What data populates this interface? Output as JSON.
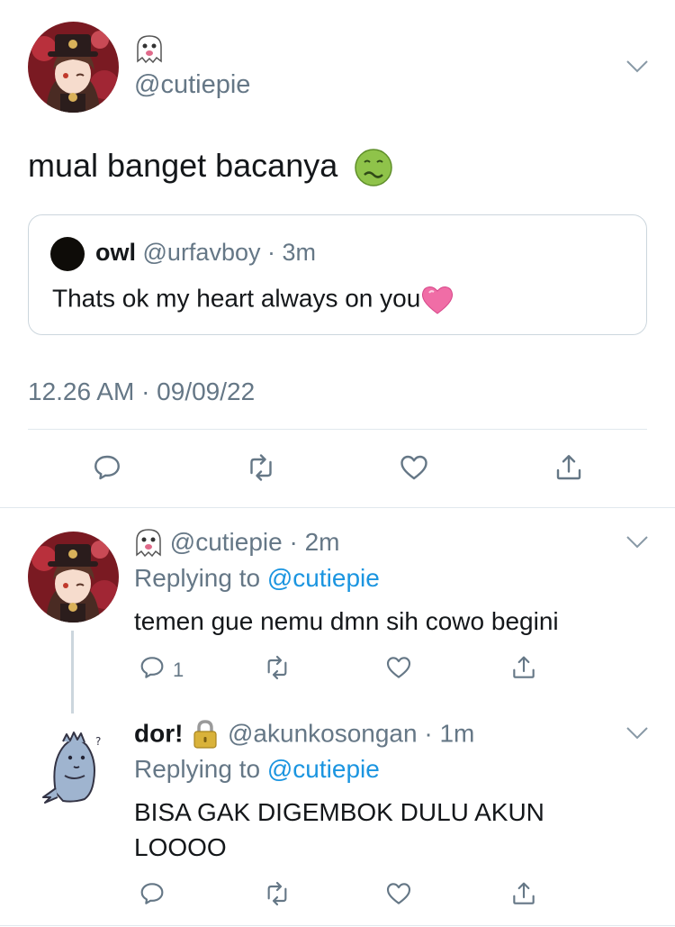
{
  "main_tweet": {
    "display_name_emoji": "ghost-emoji",
    "handle": "@cutiepie",
    "text": "mual banget bacanya",
    "text_emoji": "nauseated-face-emoji",
    "quote": {
      "name": "owl",
      "handle": "@urfavboy",
      "time": "· 3m",
      "text": "Thats ok my heart always on you",
      "text_emoji": "pink-heart-emoji"
    },
    "timestamp": "12.26 AM · 09/09/22"
  },
  "reply1": {
    "display_name_emoji": "ghost-emoji",
    "handle": "@cutiepie",
    "time": "· 2m",
    "replying_prefix": "Replying to",
    "replying_handle": "@cutiepie",
    "text": "temen gue nemu dmn sih cowo begini",
    "reply_count": "1"
  },
  "reply2": {
    "name": "dor!",
    "name_emoji": "lock-emoji",
    "handle": "@akunkosongan",
    "time": "· 1m",
    "replying_prefix": "Replying to",
    "replying_handle": "@cutiepie",
    "text_line1": "BISA GAK DIGEMBOK DULU AKUN",
    "text_line2": "LOOOO"
  },
  "colors": {
    "text": "#14171a",
    "secondary": "#657786",
    "link": "#1b95e0",
    "divider": "#e1e8ed"
  }
}
